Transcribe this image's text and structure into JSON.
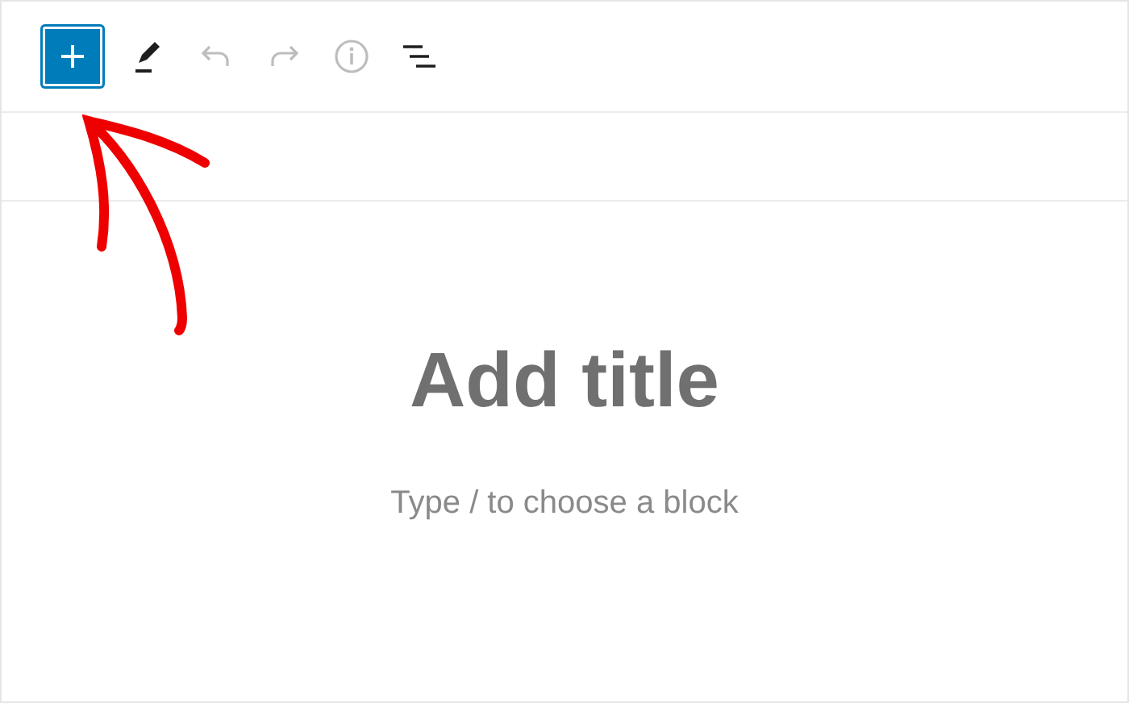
{
  "toolbar": [
    {
      "kind": "add",
      "selected": true,
      "disabled": false
    },
    {
      "kind": "edit",
      "selected": false,
      "disabled": false
    },
    {
      "kind": "undo",
      "selected": false,
      "disabled": true
    },
    {
      "kind": "redo",
      "selected": false,
      "disabled": true
    },
    {
      "kind": "info",
      "selected": false,
      "disabled": true
    },
    {
      "kind": "outline",
      "selected": false,
      "disabled": false
    }
  ],
  "editor": {
    "title": {
      "placeholder": "Add title"
    },
    "block": {
      "placeholder": "Type / to choose a block"
    }
  }
}
